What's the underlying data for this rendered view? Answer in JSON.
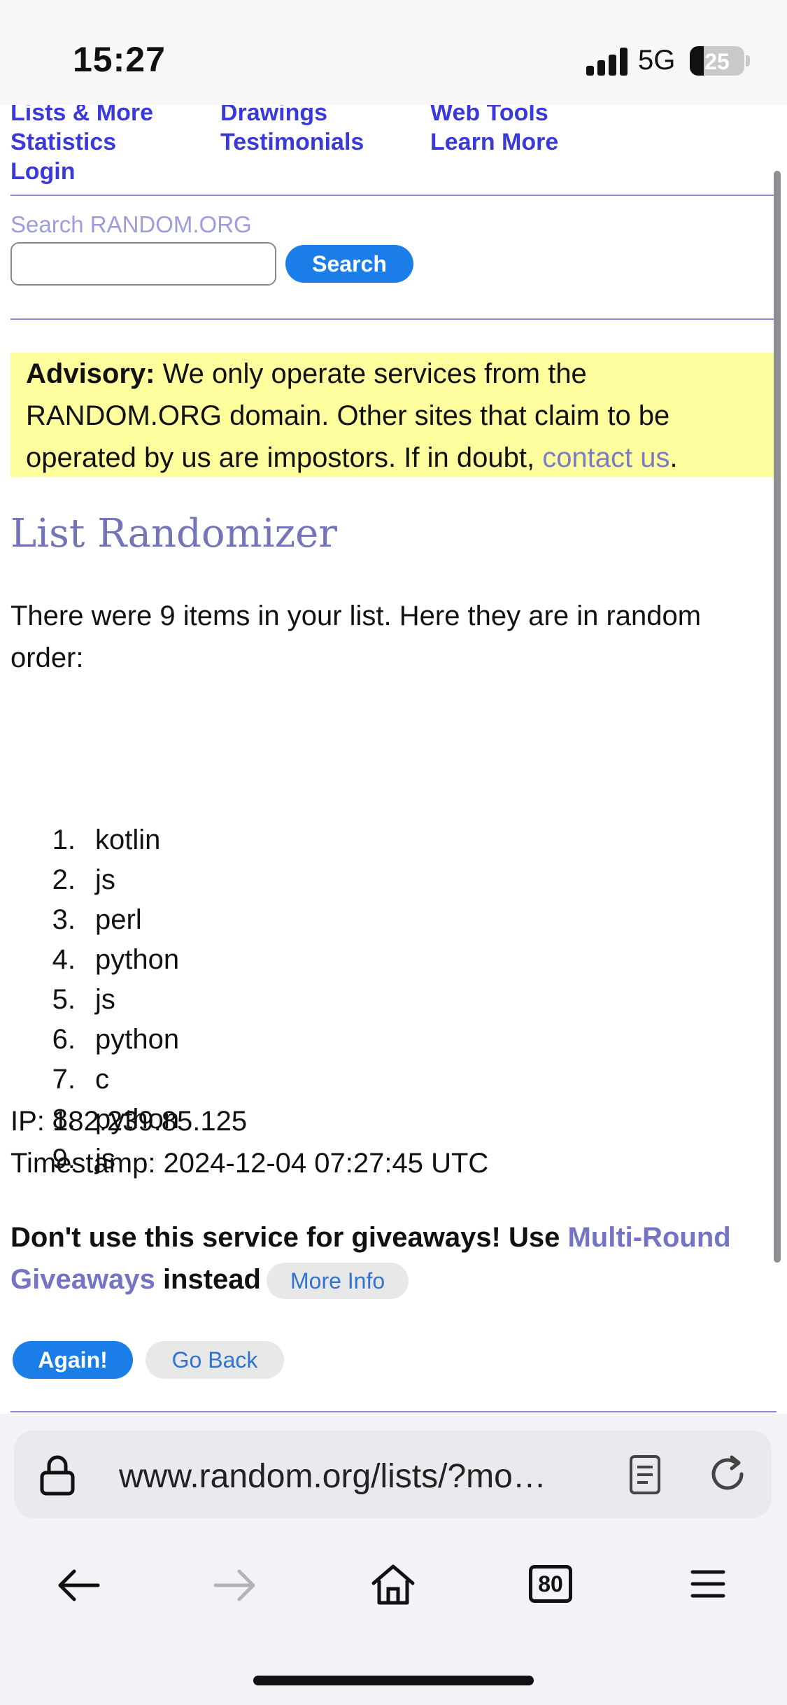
{
  "status_bar": {
    "time": "15:27",
    "network": "5G",
    "battery": "25"
  },
  "nav": {
    "links": [
      "Lists & More",
      "Drawings",
      "Web Tools",
      "Statistics",
      "Testimonials",
      "Learn More",
      "Login"
    ]
  },
  "search": {
    "label": "Search RANDOM.ORG",
    "value": "",
    "button": "Search"
  },
  "advisory": {
    "bold": "Advisory:",
    "text": " We only operate services from the RANDOM.ORG domain. Other sites that claim to be operated by us are impostors. If in doubt, ",
    "link": "contact us",
    "end": "."
  },
  "page_title": "List Randomizer",
  "intro": "There were 9 items in your list. Here they are in random order:",
  "list": [
    {
      "n": "1.",
      "v": "kotlin"
    },
    {
      "n": "2.",
      "v": "js"
    },
    {
      "n": "3.",
      "v": "perl"
    },
    {
      "n": "4.",
      "v": "python"
    },
    {
      "n": "5.",
      "v": "js"
    },
    {
      "n": "6.",
      "v": "python"
    },
    {
      "n": "7.",
      "v": "c"
    },
    {
      "n": "8.",
      "v": "python"
    },
    {
      "n": "9.",
      "v": "js"
    }
  ],
  "ip": "IP: 182.239.85.125",
  "timestamp": "Timestamp: 2024-12-04 07:27:45 UTC",
  "warning": {
    "text": "Don't use this service for giveaways! Use ",
    "link": "Multi-Round Giveaways",
    "after": " instead",
    "more_info": "More Info"
  },
  "buttons": {
    "again": "Again!",
    "back": "Go Back"
  },
  "browser": {
    "url": "www.random.org/lists/?mo…",
    "tab_count": "80"
  }
}
